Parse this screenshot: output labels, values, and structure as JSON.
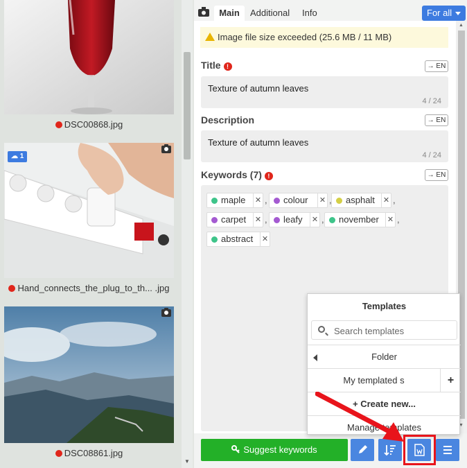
{
  "gallery": {
    "items": [
      {
        "filename": "DSC00868.jpg"
      },
      {
        "filename": "Hand_connects_the_plug_to_th... .jpg",
        "badge_count": "1"
      },
      {
        "filename": "DSC08861.jpg"
      }
    ]
  },
  "tabs": {
    "main": "Main",
    "additional": "Additional",
    "info": "Info",
    "scope": "For all"
  },
  "warning": "Image file size exceeded (25.6 MB / 11 MB)",
  "title": {
    "label": "Title",
    "lang": "→ EN",
    "value": "Texture of autumn leaves",
    "counter": "4 / 24"
  },
  "description": {
    "label": "Description",
    "lang": "→ EN",
    "value": "Texture of autumn leaves",
    "counter": "4 / 24"
  },
  "keywords": {
    "label": "Keywords (7)",
    "lang": "→ EN",
    "items": [
      {
        "text": "maple",
        "color": "#3ec48a"
      },
      {
        "text": "colour",
        "color": "#a45ad1"
      },
      {
        "text": "asphalt",
        "color": "#d4cf46"
      },
      {
        "text": "carpet",
        "color": "#a45ad1"
      },
      {
        "text": "leafy",
        "color": "#a45ad1"
      },
      {
        "text": "november",
        "color": "#3ec48a"
      },
      {
        "text": "abstract",
        "color": "#3ec48a"
      }
    ]
  },
  "templates_popup": {
    "title": "Templates",
    "search_placeholder": "Search templates",
    "folder": "Folder",
    "my_template": "My templated s",
    "create_new": "+ Create new...",
    "manage": "Manage templates"
  },
  "bottom_bar": {
    "suggest": "Suggest keywords"
  },
  "colors": {
    "accent": "#4a86e0",
    "suggest_green": "#23b028",
    "error_red": "#e0261b",
    "highlight": "#e8141b"
  }
}
